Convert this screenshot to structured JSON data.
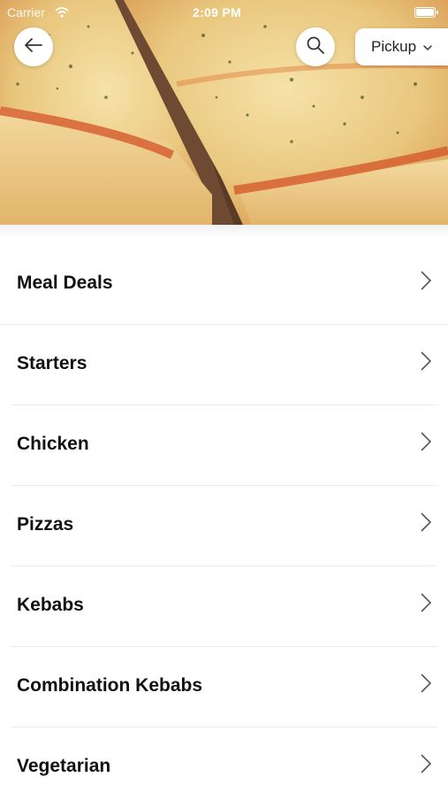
{
  "status_bar": {
    "carrier": "Carrier",
    "time": "2:09 PM"
  },
  "header": {
    "back_icon": "arrow-left-icon",
    "search_icon": "search-icon",
    "pickup_label": "Pickup",
    "pickup_icon": "chevron-down-icon"
  },
  "menu": {
    "items": [
      {
        "label": "Meal Deals"
      },
      {
        "label": "Starters"
      },
      {
        "label": "Chicken"
      },
      {
        "label": "Pizzas"
      },
      {
        "label": "Kebabs"
      },
      {
        "label": "Combination Kebabs"
      },
      {
        "label": "Vegetarian"
      }
    ]
  }
}
